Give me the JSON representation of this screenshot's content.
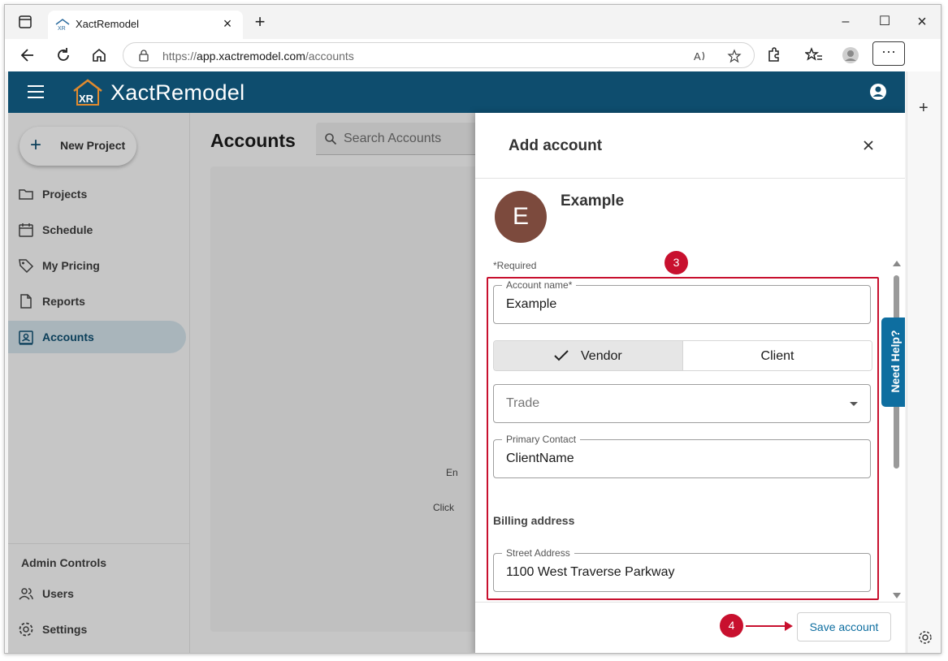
{
  "browser": {
    "tab_title": "XactRemodel",
    "url_prefix": "https://",
    "url_host": "app.xactremodel.com",
    "url_path": "/accounts",
    "new_tab_symbol": "+",
    "more_symbol": "···"
  },
  "app": {
    "brand": "XactRemodel",
    "logo_text": "XR",
    "colors": {
      "header": "#0e4d6e",
      "accent": "#0e6ea0",
      "annotation": "#c8102e",
      "avatar": "#7c4a3d"
    }
  },
  "sidebar": {
    "new_project_label": "New Project",
    "items": [
      {
        "label": "Projects",
        "icon": "folder-icon"
      },
      {
        "label": "Schedule",
        "icon": "calendar-icon"
      },
      {
        "label": "My Pricing",
        "icon": "tag-icon"
      },
      {
        "label": "Reports",
        "icon": "document-icon"
      },
      {
        "label": "Accounts",
        "icon": "contact-card-icon",
        "active": true
      }
    ],
    "admin_title": "Admin Controls",
    "admin_items": [
      {
        "label": "Users",
        "icon": "users-icon"
      },
      {
        "label": "Settings",
        "icon": "gear-icon"
      }
    ]
  },
  "main": {
    "title": "Accounts",
    "search_placeholder": "Search Accounts",
    "fragment_1": "En",
    "fragment_2": "Click"
  },
  "drawer": {
    "title": "Add account",
    "avatar_letter": "E",
    "avatar_name": "Example",
    "required_note": "*Required",
    "account_name_label": "Account name*",
    "account_name_value": "Example",
    "type_options": [
      "Vendor",
      "Client"
    ],
    "type_selected": "Vendor",
    "trade_placeholder": "Trade",
    "primary_contact_label": "Primary Contact",
    "primary_contact_value": "ClientName",
    "billing_heading": "Billing address",
    "street_label": "Street Address",
    "street_value": "1100 West Traverse Parkway",
    "save_label": "Save account"
  },
  "annotations": {
    "step_form": "3",
    "step_save": "4"
  },
  "need_help_label": "Need Help?"
}
